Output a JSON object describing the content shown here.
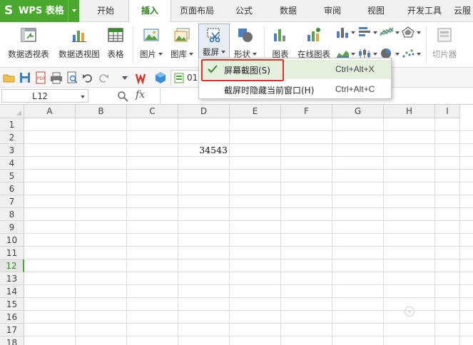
{
  "app": {
    "logo": "S",
    "title": "WPS 表格"
  },
  "tabs": [
    "开始",
    "插入",
    "页面布局",
    "公式",
    "数据",
    "审阅",
    "视图",
    "开发工具",
    "云服"
  ],
  "active_tab": "插入",
  "ribbon": {
    "pivot_table": "数据透视表",
    "pivot_chart": "数据透视图",
    "table": "表格",
    "picture": "图片",
    "gallery": "图库",
    "screenshot": "截屏",
    "shapes": "形状",
    "chart": "图表",
    "online_chart": "在线图表",
    "slicer": "切片器"
  },
  "quick_access": {
    "file_tab": "01"
  },
  "formula_bar": {
    "cell_ref": "L12",
    "fx_label": "fx",
    "value": ""
  },
  "grid": {
    "columns": [
      "A",
      "B",
      "C",
      "D",
      "E",
      "F",
      "G",
      "H",
      "I"
    ],
    "rows": [
      "1",
      "2",
      "3",
      "4",
      "5",
      "6",
      "7",
      "8",
      "9",
      "10",
      "11",
      "12",
      "13",
      "14",
      "15",
      "16",
      "17",
      "18"
    ],
    "active_row": "12",
    "cells": {
      "D3": "34543"
    }
  },
  "screenshot_menu": {
    "items": [
      {
        "label": "屏幕截图(S)",
        "shortcut": "Ctrl+Alt+X",
        "checked": true
      },
      {
        "label": "截屏时隐藏当前窗口(H)",
        "shortcut": "Ctrl+Alt+C",
        "checked": false
      }
    ]
  },
  "watermark": "",
  "colors": {
    "brand": "#4aa82f",
    "highlight": "#e0302a",
    "menu_hover": "#e4efde",
    "active_row": "#3cae2a"
  }
}
